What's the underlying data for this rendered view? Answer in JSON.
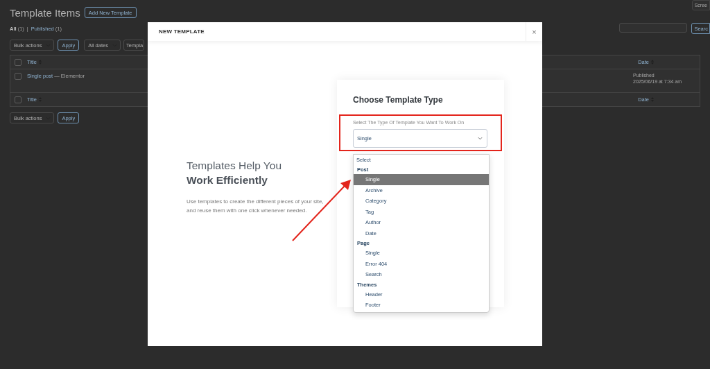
{
  "screen_options": "Scree",
  "page": {
    "title": "Template Items",
    "add_button": "Add New Template"
  },
  "views": [
    {
      "label": "All",
      "count": "(1)",
      "selected": true
    },
    {
      "label": "Published",
      "count": "(1)",
      "selected": false
    }
  ],
  "views_separator": "|",
  "search": {
    "button": "Searc"
  },
  "top_actions": {
    "bulk": "Bulk actions",
    "apply": "Apply",
    "dates": "All dates",
    "type": "Templa"
  },
  "table": {
    "columns": [
      "Title",
      "Date"
    ],
    "header_checked": false,
    "footer_columns": [
      "Title",
      "Date"
    ],
    "footer_checked": false,
    "rows": [
      {
        "title": "Single post",
        "suffix": "— Elementor",
        "status": "Published",
        "date": "2025/06/19 at 7:34 am",
        "checked": false
      }
    ]
  },
  "bottom_actions": {
    "bulk": "Bulk actions",
    "apply": "Apply"
  },
  "modal": {
    "title": "NEW TEMPLATE",
    "close": "×",
    "heading": "Templates Help You",
    "heading_bold": "Work Efficiently",
    "description": "Use templates to create the different pieces of your site, and reuse them with one click whenever needed.",
    "card_title": "Choose Template Type",
    "field_label": "Select The Type Of Template You Want To Work On",
    "select_value": "Single",
    "dropdown": {
      "placeholder": "Select",
      "groups": [
        {
          "label": "Post",
          "options": [
            {
              "label": "Single",
              "selected": true
            },
            {
              "label": "Archive",
              "selected": false
            },
            {
              "label": "Category",
              "selected": false
            },
            {
              "label": "Tag",
              "selected": false
            },
            {
              "label": "Author",
              "selected": false
            },
            {
              "label": "Date",
              "selected": false
            }
          ]
        },
        {
          "label": "Page",
          "options": [
            {
              "label": "Single",
              "selected": false
            },
            {
              "label": "Error 404",
              "selected": false
            },
            {
              "label": "Search",
              "selected": false
            }
          ]
        },
        {
          "label": "Themes",
          "options": [
            {
              "label": "Header",
              "selected": false
            },
            {
              "label": "Footer",
              "selected": false
            }
          ]
        }
      ]
    }
  }
}
